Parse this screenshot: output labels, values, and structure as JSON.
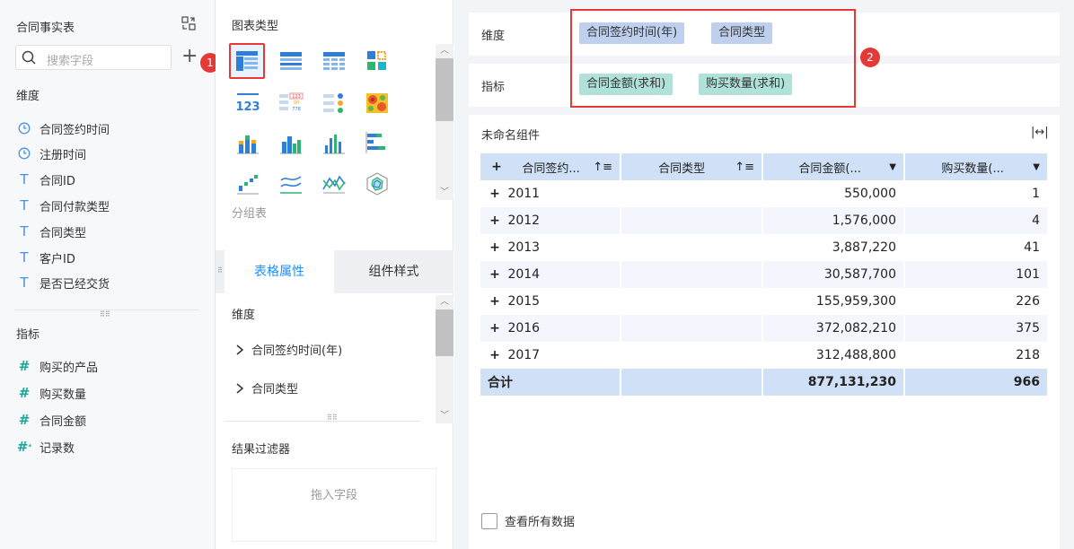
{
  "left": {
    "title": "合同事实表",
    "search_placeholder": "搜索字段",
    "dimensions_label": "维度",
    "dimensions": [
      "合同签约时间",
      "注册时间",
      "合同ID",
      "合同付款类型",
      "合同类型",
      "客户ID",
      "是否已经交货"
    ],
    "dimension_icons": [
      "clock-icon",
      "clock-icon",
      "text-type-icon",
      "text-type-icon",
      "text-type-icon",
      "text-type-icon",
      "text-type-icon"
    ],
    "measures_label": "指标",
    "measures": [
      "购买的产品",
      "购买数量",
      "合同金额",
      "记录数"
    ],
    "badge1": "1"
  },
  "middle": {
    "chart_types_title": "图表类型",
    "chart_type_icons": [
      "group-table-icon",
      "detail-table-icon",
      "cross-table-icon",
      "custom-chart-icon",
      "kpi-icon",
      "text-widget-icon",
      "dot-matrix-icon",
      "heatmap-icon",
      "stacked-bar-icon",
      "grouped-bar-icon",
      "column-chart-icon",
      "horizontal-bar-icon",
      "scatter-icon",
      "line-chart-icon",
      "area-line-icon",
      "radar-icon"
    ],
    "selected_chart_name": "分组表",
    "tab_active": "表格属性",
    "tab_other": "组件样式",
    "prop_dimension_label": "维度",
    "prop_items": [
      "合同签约时间(年)",
      "合同类型"
    ],
    "filter_title": "结果过滤器",
    "filter_drop_hint": "拖入字段"
  },
  "right": {
    "dimension_label": "维度",
    "dimension_pills": [
      "合同签约时间(年)",
      "合同类型"
    ],
    "measure_label": "指标",
    "measure_pills": [
      "合同金额(求和)",
      "购买数量(求和)"
    ],
    "badge2": "2",
    "widget_title": "未命名组件",
    "columns": [
      "合同签约...",
      "合同类型",
      "合同金额(...",
      "购买数量(..."
    ],
    "rows": [
      {
        "year": "2011",
        "type": "",
        "amount": "550,000",
        "qty": "1"
      },
      {
        "year": "2012",
        "type": "",
        "amount": "1,576,000",
        "qty": "4"
      },
      {
        "year": "2013",
        "type": "",
        "amount": "3,887,220",
        "qty": "41"
      },
      {
        "year": "2014",
        "type": "",
        "amount": "30,587,700",
        "qty": "101"
      },
      {
        "year": "2015",
        "type": "",
        "amount": "155,959,300",
        "qty": "226"
      },
      {
        "year": "2016",
        "type": "",
        "amount": "372,082,210",
        "qty": "375"
      },
      {
        "year": "2017",
        "type": "",
        "amount": "312,488,800",
        "qty": "218"
      }
    ],
    "total_label": "合计",
    "total_amount": "877,131,230",
    "total_qty": "966",
    "show_all_label": "查看所有数据",
    "show_all_checked": false
  }
}
